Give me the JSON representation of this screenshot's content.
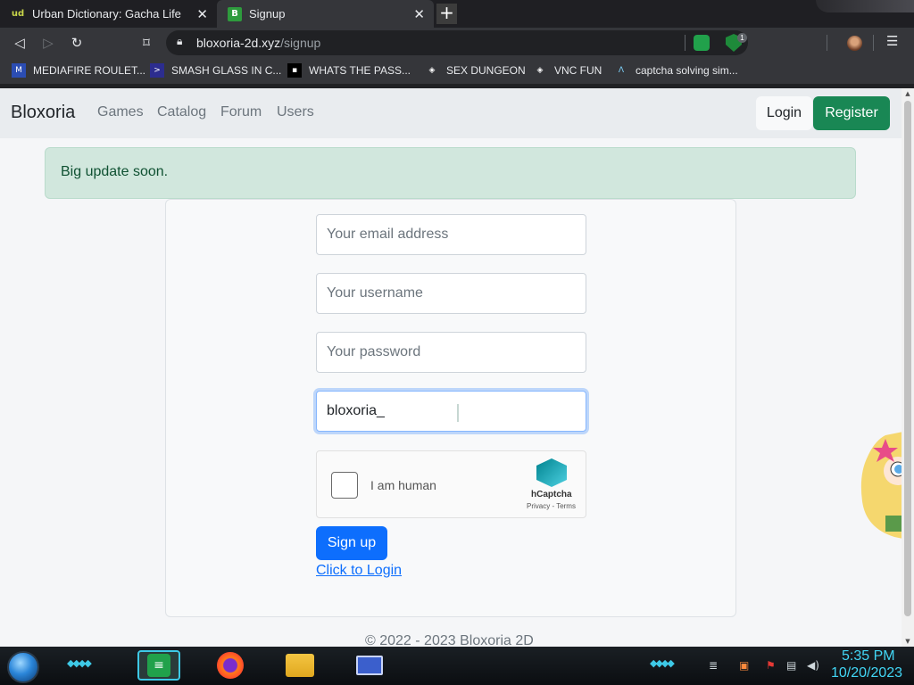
{
  "browser": {
    "tabs": [
      {
        "label": "Urban Dictionary: Gacha Life",
        "favicon": "ud-favicon",
        "favicon_text": "ud"
      },
      {
        "label": "Signup",
        "favicon": "bloxoria-favicon",
        "favicon_text": "B"
      }
    ],
    "close_glyph": "✕",
    "new_tab_glyph": "+",
    "url_host": "bloxoria-2d.xyz",
    "url_path": "/signup",
    "ext_badge": "1",
    "bookmarks": [
      {
        "label": "MEDIAFIRE ROULET...",
        "icon": "mediafire-icon"
      },
      {
        "label": "SMASH GLASS IN C...",
        "icon": "smash-icon"
      },
      {
        "label": "WHATS THE PASS...",
        "icon": "terminal-icon"
      },
      {
        "label": "SEX DUNGEON",
        "icon": "roblox-icon"
      },
      {
        "label": "VNC FUN",
        "icon": "roblox-icon"
      },
      {
        "label": "captcha solving sim...",
        "icon": "arch-icon"
      }
    ]
  },
  "site": {
    "brand": "Bloxoria",
    "nav": [
      "Games",
      "Catalog",
      "Forum",
      "Users"
    ],
    "login_label": "Login",
    "register_label": "Register",
    "alert": "Big update soon.",
    "form": {
      "email_placeholder": "Your email address",
      "username_placeholder": "Your username",
      "password_placeholder": "Your password",
      "active_value": "bloxoria_",
      "captcha_label": "I am human",
      "captcha_brand": "hCaptcha",
      "captcha_legal": "Privacy - Terms",
      "signup_label": "Sign up",
      "login_link": "Click to Login"
    },
    "footer": "© 2022 - 2023 Bloxoria 2D"
  },
  "taskbar": {
    "time": "5:35 PM",
    "date": "10/20/2023",
    "apps": [
      "spotify-icon",
      "firefox-icon",
      "file-explorer-icon",
      "window-app-icon"
    ]
  },
  "colors": {
    "register": "#198754",
    "signup": "#0d6efd",
    "alert_bg": "#d1e7dd",
    "clock": "#42d6f5"
  }
}
